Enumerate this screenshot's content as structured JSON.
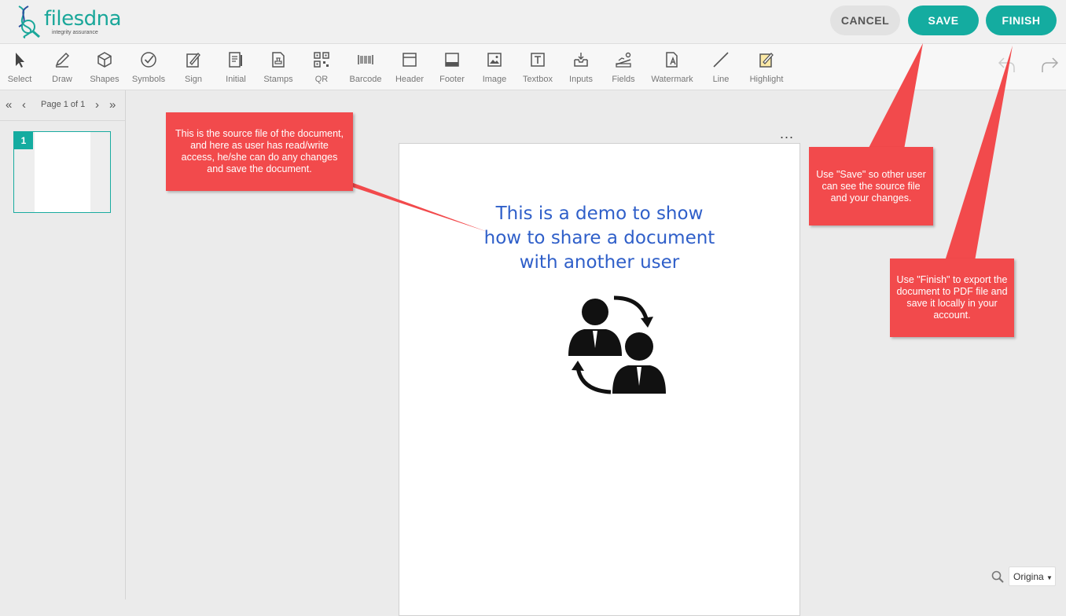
{
  "app": {
    "logo_text": "filesdna",
    "logo_tagline": "integrity assurance"
  },
  "header": {
    "cancel_label": "CANCEL",
    "save_label": "SAVE",
    "finish_label": "FINISH"
  },
  "toolbar": {
    "tools": [
      {
        "label": "Select",
        "icon": "cursor-icon"
      },
      {
        "label": "Draw",
        "icon": "pen-icon"
      },
      {
        "label": "Shapes",
        "icon": "cube-icon"
      },
      {
        "label": "Symbols",
        "icon": "check-circle-icon"
      },
      {
        "label": "Sign",
        "icon": "signature-icon"
      },
      {
        "label": "Initial",
        "icon": "initial-icon"
      },
      {
        "label": "Stamps",
        "icon": "stamp-icon"
      },
      {
        "label": "QR",
        "icon": "qr-icon"
      },
      {
        "label": "Barcode",
        "icon": "barcode-icon"
      },
      {
        "label": "Header",
        "icon": "header-icon"
      },
      {
        "label": "Footer",
        "icon": "footer-icon"
      },
      {
        "label": "Image",
        "icon": "image-icon"
      },
      {
        "label": "Textbox",
        "icon": "textbox-icon"
      },
      {
        "label": "Inputs",
        "icon": "inbox-icon"
      },
      {
        "label": "Fields",
        "icon": "fields-icon"
      },
      {
        "label": "Watermark",
        "icon": "watermark-icon"
      },
      {
        "label": "Line",
        "icon": "line-icon"
      },
      {
        "label": "Highlight",
        "icon": "highlight-icon"
      }
    ]
  },
  "sidebar": {
    "page_label": "Page 1 of 1",
    "thumbnail_number": "1"
  },
  "document": {
    "title_lines": [
      "This is a demo to show",
      "how to share a document",
      "with another user"
    ],
    "more_label": "..."
  },
  "callouts": {
    "source": [
      "This is the source file of the document,",
      "and here as user has read/write",
      "access, he/she can do any changes",
      "and save the document."
    ],
    "save": [
      "Use \"Save\" so other user",
      "can see the source file",
      "and your changes."
    ],
    "finish": [
      "Use \"Finish\" to export the",
      "document to PDF file and",
      "save it locally in your",
      "account."
    ]
  },
  "zoom": {
    "value": "Origina"
  },
  "colors": {
    "accent": "#14aca0",
    "callout": "#f24a4c",
    "doc_title": "#2f5fc9"
  }
}
